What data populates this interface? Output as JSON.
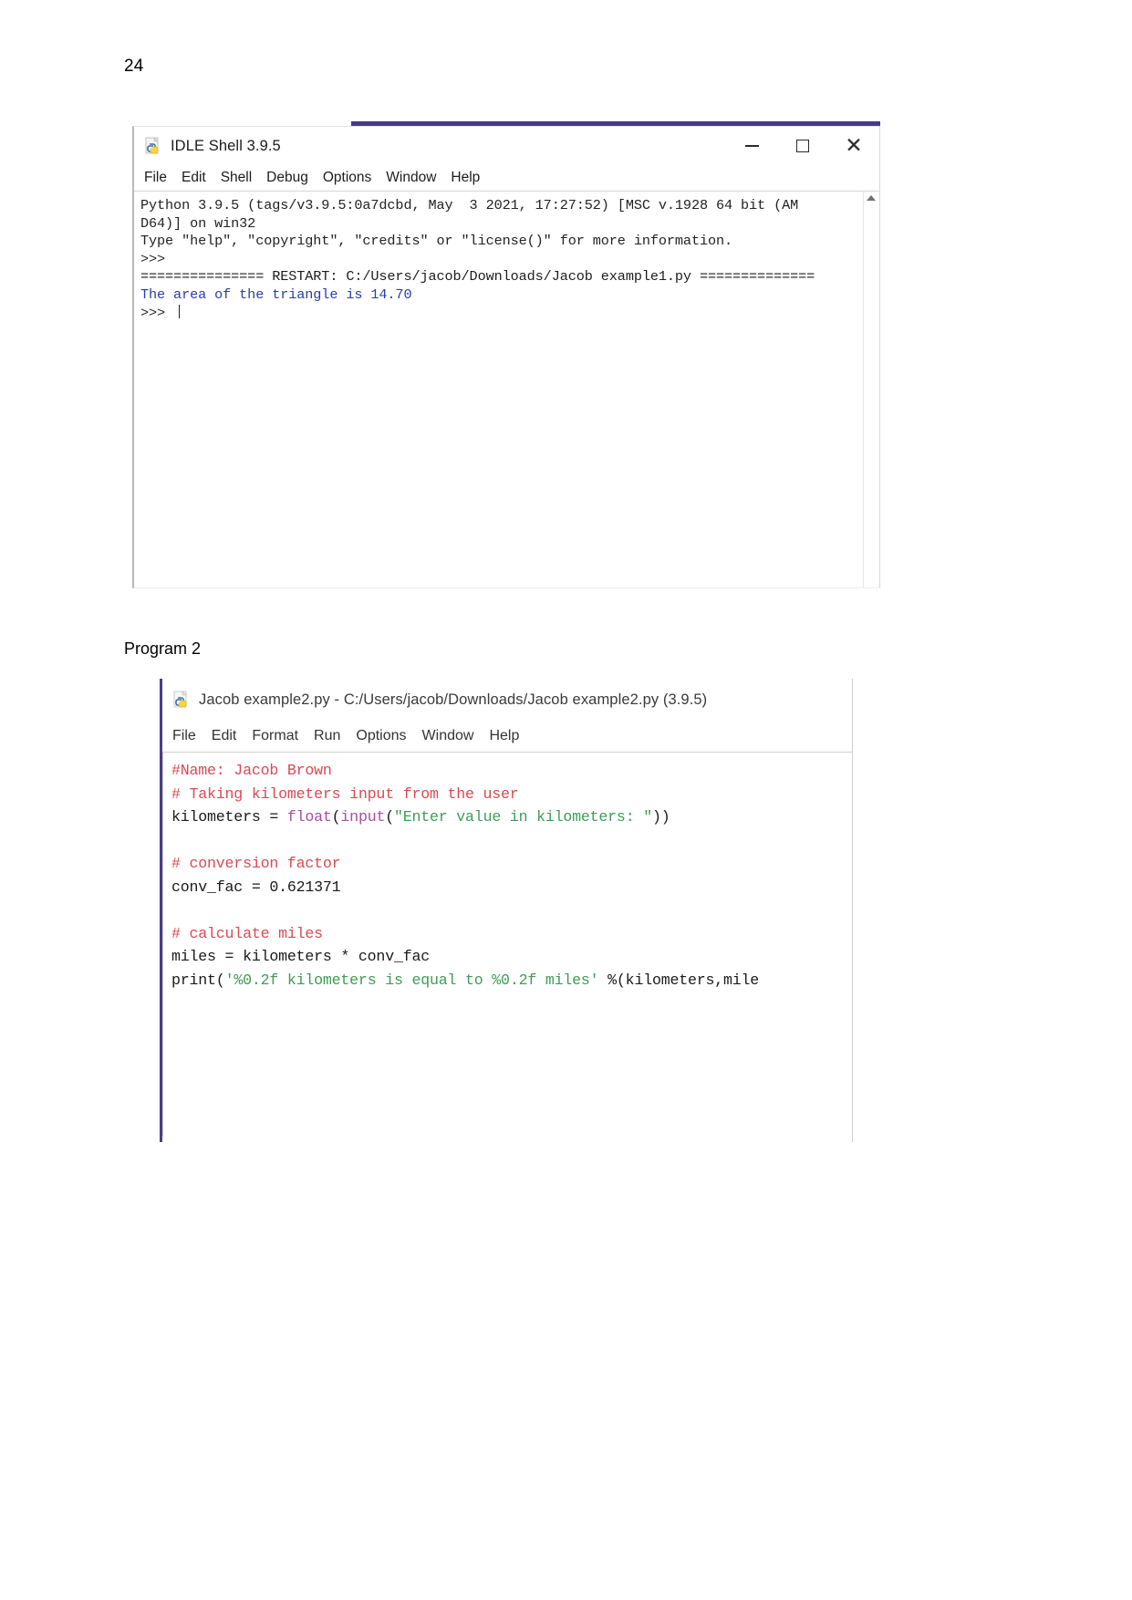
{
  "page": {
    "number": "24",
    "section_label": "Program 2"
  },
  "shell_window": {
    "title": "IDLE Shell 3.9.5",
    "icon": "python-file-icon",
    "controls": {
      "minimize": "minimize-button",
      "maximize": "maximize-button",
      "close": "✕"
    },
    "menu": [
      "File",
      "Edit",
      "Shell",
      "Debug",
      "Options",
      "Window",
      "Help"
    ],
    "console_lines": [
      {
        "kind": "plain",
        "text": "Python 3.9.5 (tags/v3.9.5:0a7dcbd, May  3 2021, 17:27:52) [MSC v.1928 64 bit (AM"
      },
      {
        "kind": "plain",
        "text": "D64)] on win32"
      },
      {
        "kind": "plain",
        "text": "Type \"help\", \"copyright\", \"credits\" or \"license()\" for more information."
      },
      {
        "kind": "prompt",
        "text": ">>>"
      },
      {
        "kind": "restart",
        "text": "=============== RESTART: C:/Users/jacob/Downloads/Jacob example1.py =============="
      },
      {
        "kind": "output",
        "text": "The area of the triangle is 14.70"
      },
      {
        "kind": "prompt_cursor",
        "text": ">>> "
      }
    ]
  },
  "editor_window": {
    "title": "Jacob example2.py - C:/Users/jacob/Downloads/Jacob example2.py (3.9.5)",
    "icon": "python-file-icon",
    "menu": [
      "File",
      "Edit",
      "Format",
      "Run",
      "Options",
      "Window",
      "Help"
    ],
    "code_lines": [
      [
        {
          "t": "comment",
          "s": "#Name: Jacob Brown"
        }
      ],
      [
        {
          "t": "comment",
          "s": "# Taking kilometers input from the user"
        }
      ],
      [
        {
          "t": "plain",
          "s": "kilometers = "
        },
        {
          "t": "builtin",
          "s": "float"
        },
        {
          "t": "plain",
          "s": "("
        },
        {
          "t": "builtin",
          "s": "input"
        },
        {
          "t": "plain",
          "s": "("
        },
        {
          "t": "string",
          "s": "\"Enter value in kilometers: \""
        },
        {
          "t": "plain",
          "s": "))"
        }
      ],
      [
        {
          "t": "plain",
          "s": ""
        }
      ],
      [
        {
          "t": "comment",
          "s": "# conversion factor"
        }
      ],
      [
        {
          "t": "plain",
          "s": "conv_fac = 0.621371"
        }
      ],
      [
        {
          "t": "plain",
          "s": ""
        }
      ],
      [
        {
          "t": "comment",
          "s": "# calculate miles"
        }
      ],
      [
        {
          "t": "plain",
          "s": "miles = kilometers * conv_fac"
        }
      ],
      [
        {
          "t": "plain",
          "s": "print("
        },
        {
          "t": "string",
          "s": "'%0.2f kilometers is equal to %0.2f miles'"
        },
        {
          "t": "plain",
          "s": " %(kilometers,mile"
        }
      ]
    ]
  },
  "colors": {
    "title_band_purple": "#463b7e",
    "editor_band_purple": "#4a3f86",
    "shell_output_blue": "#2a3da8",
    "code_comment_red": "#d94a52",
    "code_string_green": "#3f9c56",
    "code_builtin_purple": "#a74fa0"
  }
}
